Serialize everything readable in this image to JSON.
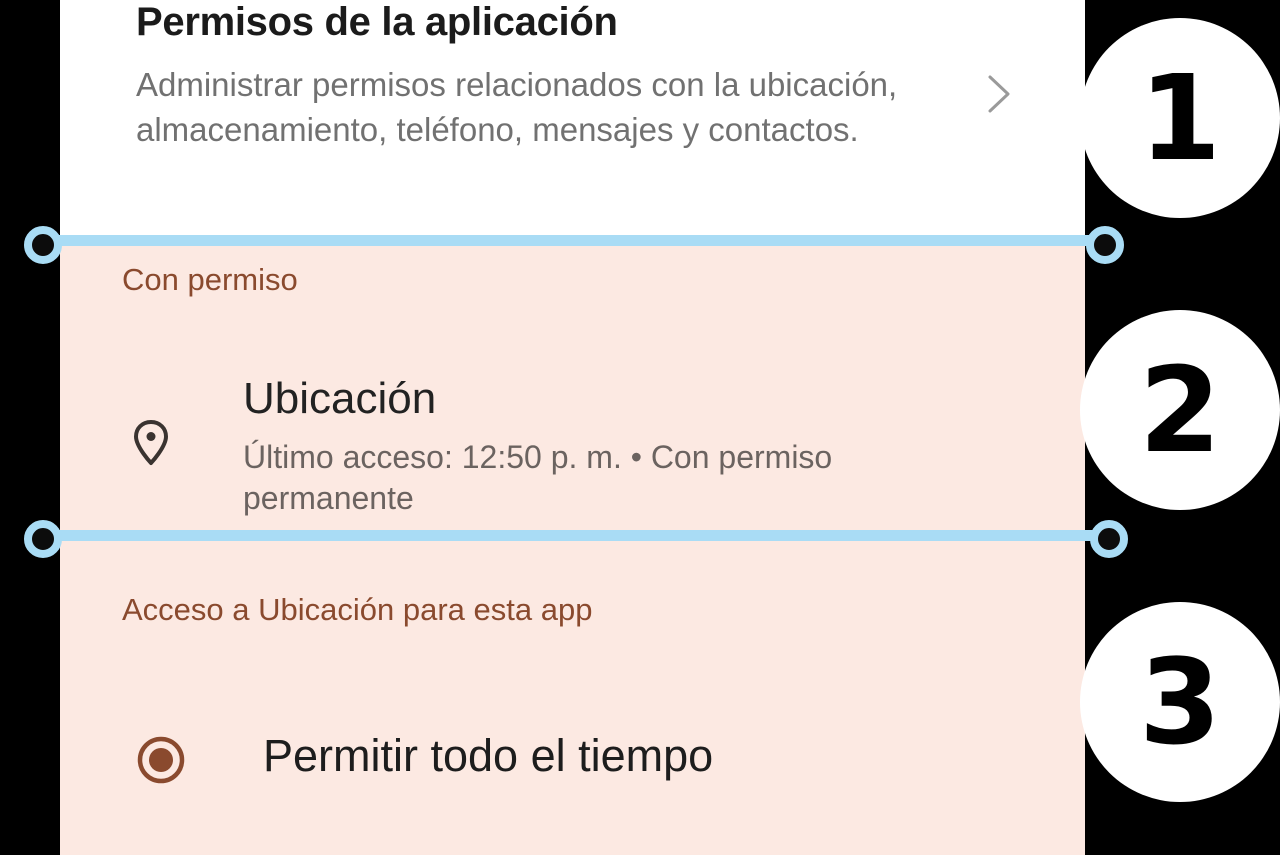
{
  "app_permissions": {
    "title": "Permisos de la aplicación",
    "description": "Administrar permisos relacionados con la ubicación, almacenamiento, teléfono, mensajes y contactos."
  },
  "allowed_section": {
    "header": "Con permiso",
    "location": {
      "title": "Ubicación",
      "subtitle": "Último acceso: 12:50 p. m. • Con permiso permanente"
    }
  },
  "location_access": {
    "header": "Acceso a Ubicación para esta app",
    "selected_option": "Permitir todo el tiempo"
  },
  "badges": [
    "1",
    "2",
    "3"
  ],
  "colors": {
    "section_header": "#8a4a2e",
    "panel_highlight": "#fce9e2",
    "divider": "#a9dcf5",
    "radio_selected": "#8a4a2e"
  }
}
